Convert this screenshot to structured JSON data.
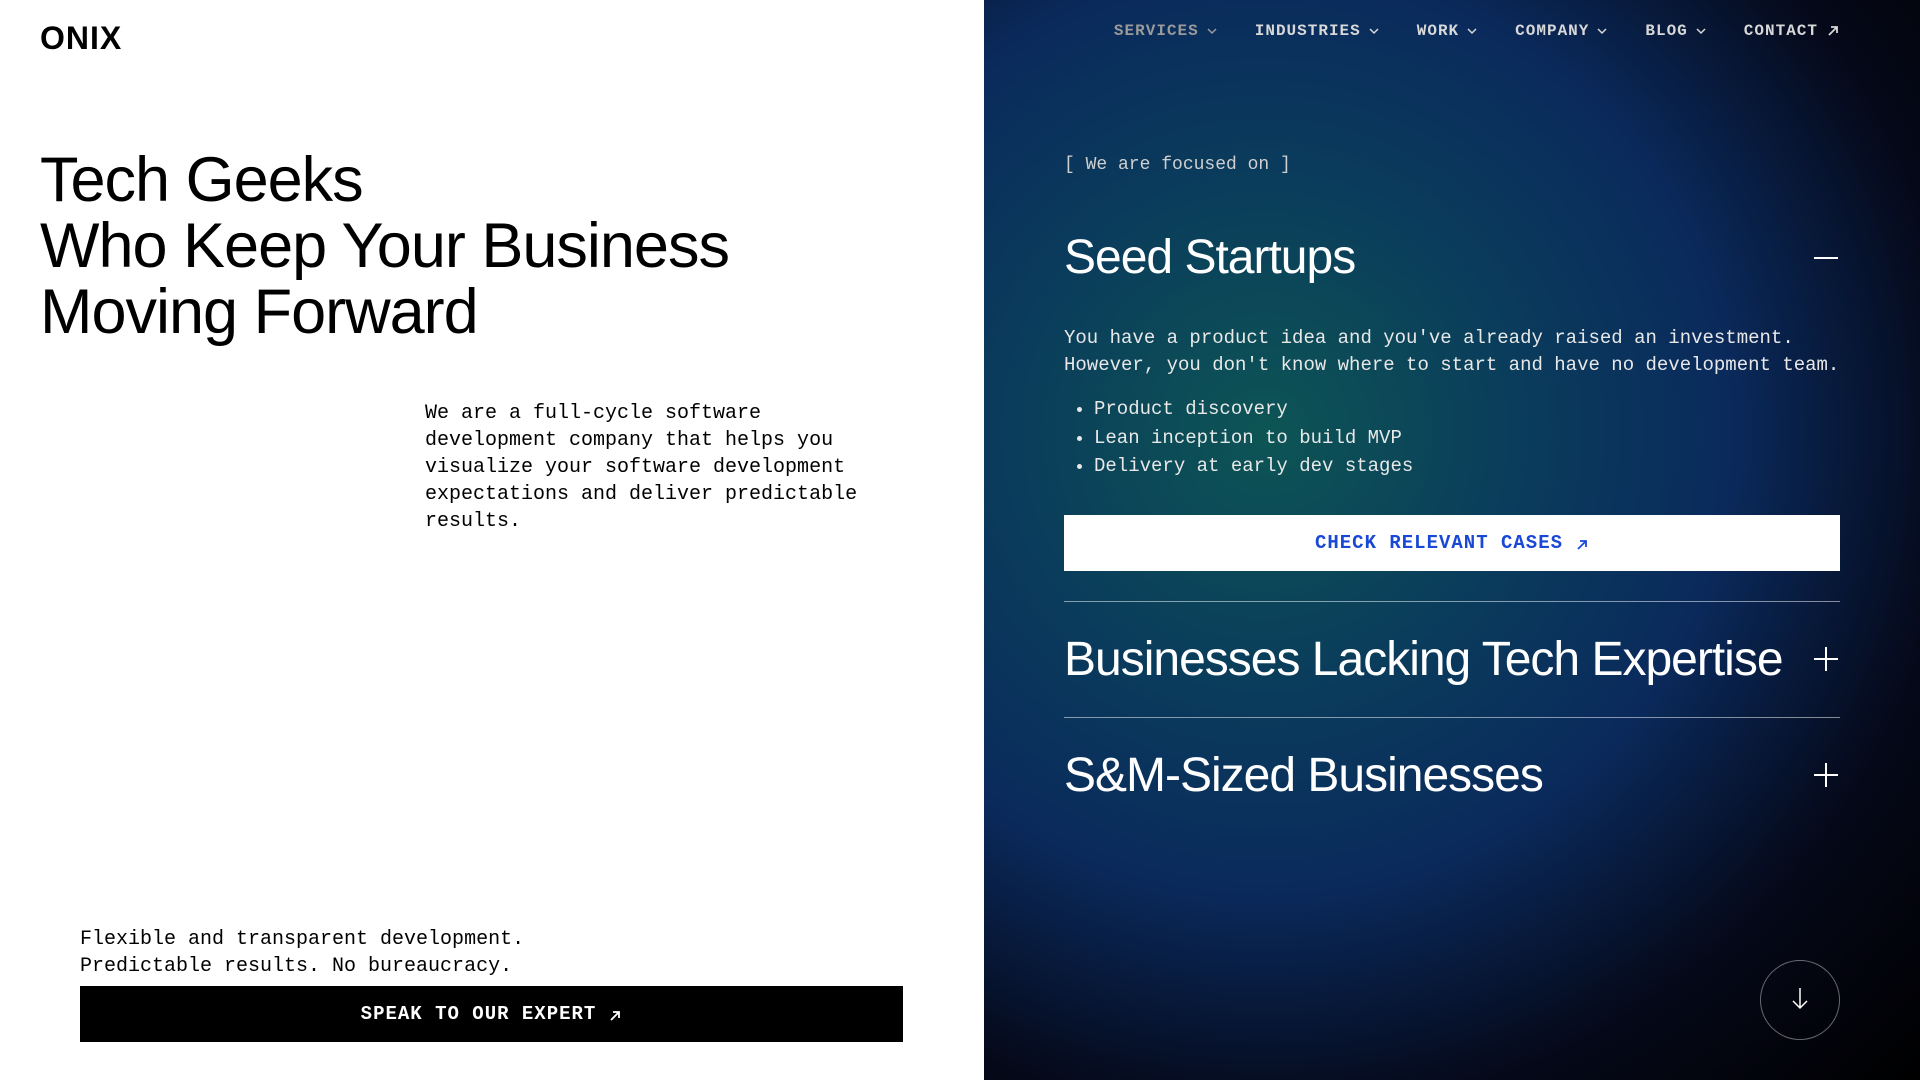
{
  "logo": "ONIX",
  "nav": {
    "items": [
      {
        "label": "SERVICES",
        "has_chevron": true,
        "active": true
      },
      {
        "label": "INDUSTRIES",
        "has_chevron": true,
        "active": false
      },
      {
        "label": "WORK",
        "has_chevron": true,
        "active": false
      },
      {
        "label": "COMPANY",
        "has_chevron": true,
        "active": false
      },
      {
        "label": "BLOG",
        "has_chevron": true,
        "active": false
      },
      {
        "label": "CONTACT",
        "has_chevron": false,
        "has_arrow": true,
        "active": false
      }
    ]
  },
  "hero": {
    "title_line1": "Tech Geeks",
    "title_line2": "Who Keep Your Business",
    "title_line3": "Moving Forward",
    "description": "We are a full-cycle software development company that helps you visualize your software development expectations and deliver predictable results.",
    "tagline_line1": "Flexible and transparent development.",
    "tagline_line2": "Predictable results. No bureaucracy.",
    "cta_label": "SPEAK TO OUR EXPERT"
  },
  "focus": {
    "label": "[ We are focused on ]",
    "items": [
      {
        "title": "Seed Startups",
        "expanded": true,
        "text": "You have a product idea and you've already raised an investment. However, you don't know where to start and have no development team.",
        "bullets": [
          "Product discovery",
          "Lean inception to build MVP",
          "Delivery at early dev stages"
        ],
        "cta": "CHECK RELEVANT CASES"
      },
      {
        "title": "Businesses Lacking Tech Expertise",
        "expanded": false
      },
      {
        "title": "S&M-Sized Businesses",
        "expanded": false
      }
    ]
  },
  "colors": {
    "cta_btn_bg": "#000000",
    "cases_btn_fg": "#1a48d6"
  }
}
